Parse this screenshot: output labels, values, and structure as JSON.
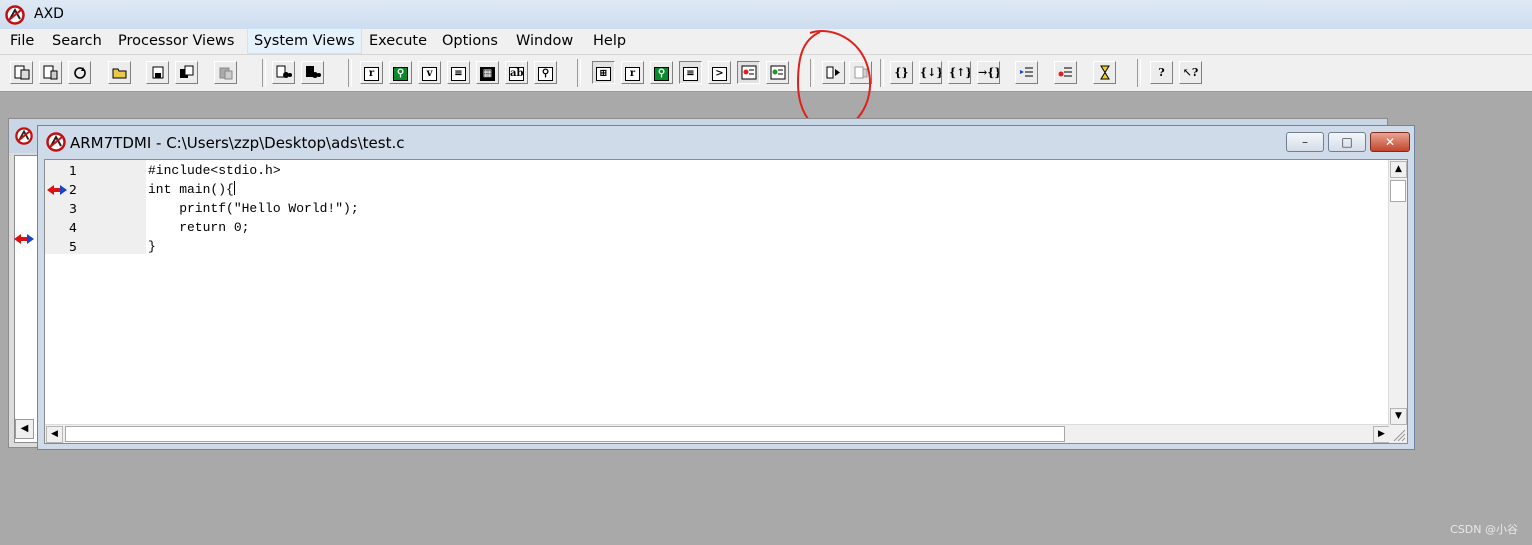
{
  "app": {
    "title": "AXD"
  },
  "menu": {
    "items": [
      "File",
      "Search",
      "Processor Views",
      "System Views",
      "Execute",
      "Options",
      "Window",
      "Help"
    ],
    "active_index": 3
  },
  "toolbar": {
    "icons": [
      "load-image-icon",
      "reload-image-icon",
      "reload-icon",
      "open-folder-icon",
      "save-icon",
      "copy-icon",
      "paste-icon",
      "find-icon",
      "find-next-icon",
      "registers-icon",
      "watch-icon",
      "variables-icon",
      "backtrace-icon",
      "memory-icon",
      "low-level-symbols-icon",
      "disassembly-icon",
      "sys-registers-icon",
      "sys-r-icon",
      "sys-watch-icon",
      "sys-list-icon",
      "console-icon",
      "breakpoints-icon",
      "sys-memory-icon",
      "go-icon",
      "stop-icon",
      "step-icon",
      "step-in-icon",
      "step-out-icon",
      "run-to-cursor-icon",
      "toggle-breakpoint-icon",
      "set-breakpoint-icon",
      "hourglass-icon",
      "help-icon",
      "context-help-icon"
    ]
  },
  "window": {
    "title": "ARM7TDMI - C:\\Users\\zzp\\Desktop\\ads\\test.c",
    "minimize_glyph": "–",
    "maximize_glyph": "□",
    "close_glyph": "✕"
  },
  "code": {
    "current_line": 2,
    "lines": [
      {
        "num": "1",
        "text": "#include<stdio.h>"
      },
      {
        "num": "2",
        "text": "int main(){"
      },
      {
        "num": "3",
        "text": "    printf(\"Hello World!\");"
      },
      {
        "num": "4",
        "text": "    return 0;"
      },
      {
        "num": "5",
        "text": "}"
      }
    ]
  },
  "scroll": {
    "up": "▲",
    "down": "▼",
    "left": "◀",
    "right": "▶"
  },
  "watermark": "CSDN @小谷",
  "colors": {
    "annotation": "#e0201a",
    "pc_marker_red": "#d11",
    "pc_marker_blue": "#1844c8"
  }
}
